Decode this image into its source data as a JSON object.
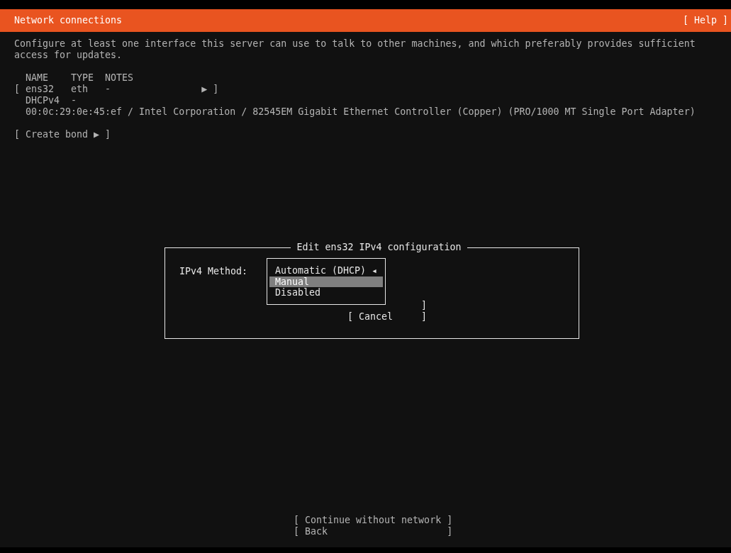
{
  "header": {
    "title": "Network connections",
    "help": "[ Help ]"
  },
  "description": "Configure at least one interface this server can use to talk to other machines, and which preferably provides sufficient access for updates.",
  "table": {
    "columns": [
      "NAME",
      "TYPE",
      "NOTES"
    ],
    "rows": [
      {
        "open": "[",
        "cells": [
          "ens32",
          "eth",
          "-"
        ],
        "arrow": "▶",
        "close": "]",
        "dhcp": [
          "DHCPv4",
          "-"
        ],
        "hardware": "00:0c:29:0e:45:ef / Intel Corporation / 82545EM Gigabit Ethernet Controller (Copper) (PRO/1000 MT Single Port Adapter)"
      }
    ]
  },
  "create_bond": "[ Create bond ▶ ]",
  "dialog": {
    "title": "Edit ens32 IPv4 configuration",
    "method_label": "IPv4 Method:",
    "method_options": [
      {
        "label": "Automatic (DHCP)",
        "marker": "◂",
        "selected": false
      },
      {
        "label": "Manual",
        "selected": true
      },
      {
        "label": "Disabled",
        "selected": false
      }
    ],
    "buttons": [
      {
        "label": "]"
      },
      {
        "label": "[ Cancel     ]"
      }
    ]
  },
  "footer_buttons": [
    "[ Continue without network ]",
    "[ Back                     ]"
  ]
}
